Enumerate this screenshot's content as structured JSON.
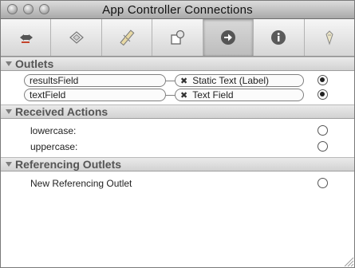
{
  "window": {
    "title": "App Controller Connections"
  },
  "toolbar": {
    "tabs": [
      {
        "icon": "attributes-icon"
      },
      {
        "icon": "effects-icon"
      },
      {
        "icon": "size-ruler-icon"
      },
      {
        "icon": "bindings-icon"
      },
      {
        "icon": "connections-arrow-icon",
        "active": true
      },
      {
        "icon": "identity-info-icon"
      },
      {
        "icon": "applescript-icon"
      }
    ]
  },
  "outlets": {
    "header": "Outlets",
    "rows": [
      {
        "name": "resultsField",
        "target": "Static Text (Label)",
        "connected": true
      },
      {
        "name": "textField",
        "target": "Text Field",
        "connected": true
      }
    ],
    "disconnect_glyph": "✖"
  },
  "received_actions": {
    "header": "Received Actions",
    "rows": [
      {
        "name": "lowercase:",
        "connected": false
      },
      {
        "name": "uppercase:",
        "connected": false
      }
    ]
  },
  "referencing_outlets": {
    "header": "Referencing Outlets",
    "rows": [
      {
        "name": "New Referencing Outlet",
        "connected": false
      }
    ]
  }
}
